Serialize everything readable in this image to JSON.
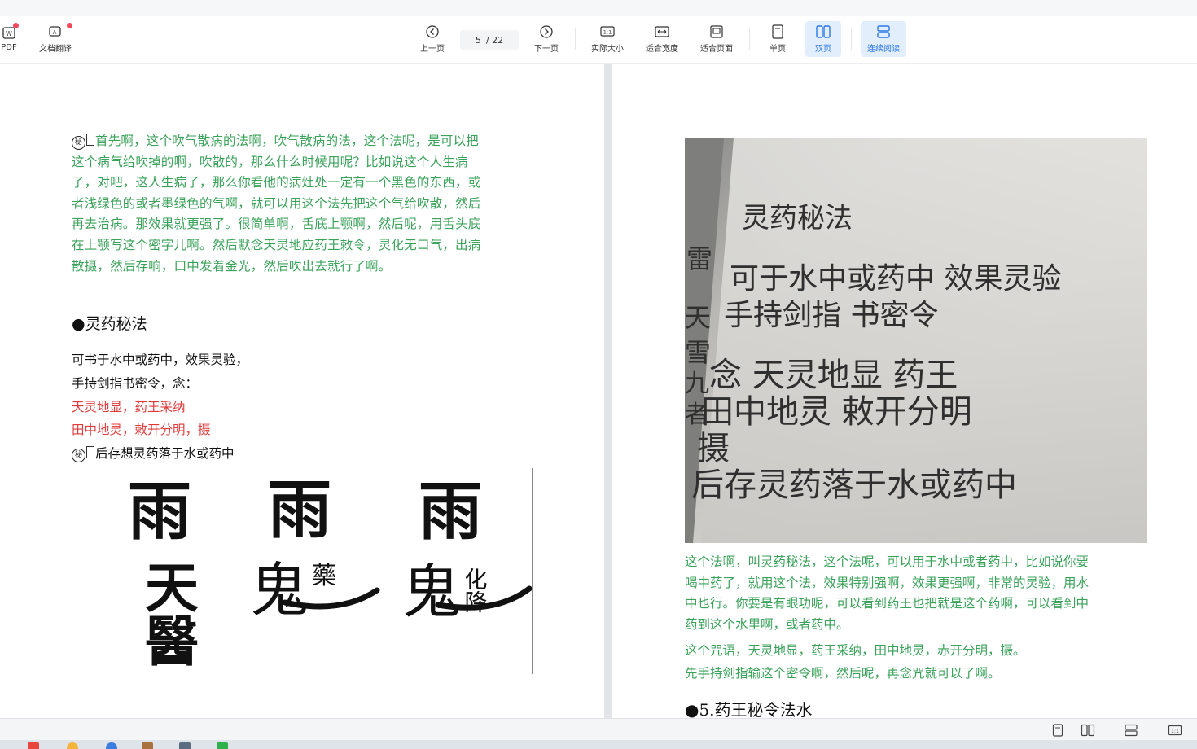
{
  "toolbar": {
    "left_items": [
      {
        "label": "PDF",
        "icon": "word-icon"
      },
      {
        "label": "文档翻译",
        "icon": "translate-icon"
      }
    ],
    "prev_label": "上一页",
    "current_page": "5",
    "total_pages": "/ 22",
    "next_label": "下一页",
    "actual_size_label": "实际大小",
    "fit_width_label": "适合宽度",
    "fit_page_label": "适合页面",
    "single_label": "单页",
    "double_label": "双页",
    "continuous_label": "连续阅读",
    "accent_color": "#2a78e8",
    "badge_color": "#f04a5e"
  },
  "left_page": {
    "intro_lines": [
      "首先啊，这个吹气散病的法啊，吹气散病的法，这个法呢，是可以把",
      "这个病气给吹掉的啊，吹散的，那么什么时候用呢？比如说这个人生病",
      "了，对吧，这人生病了，那么你看他的病灶处一定有一个黑色的东西，或",
      "者浅绿色的或者墨绿色的气啊，就可以用这个法先把这个气给吹散，然后",
      "再去治病。那效果就更强了。很简单啊，舌底上颚啊，然后呢，用舌头底",
      "在上颚写这个密字儿啊。然后默念天灵地应药王敕令，灵化无口气，出病",
      "散摄，然后存响，口中发着金光，然后吹出去就行了啊。"
    ],
    "seal_char": "秘",
    "heading": "●灵药秘法",
    "line1": "可书于水中或药中，效果灵验，",
    "line2": "手持剑指书密令，念：",
    "line3": "天灵地显，药王采纳",
    "line4": "田中地灵，敕开分明，摄",
    "line5": "后存想灵药落于水或药中",
    "glyph_top": "雨",
    "glyph1_bottom": "天醫",
    "glyph2_bottom": "鬼",
    "glyph2_inner": "藥",
    "glyph3_bottom": "鬼",
    "glyph3_inner": "化降"
  },
  "right_page": {
    "photo_lines": [
      "灵药秘法",
      "可于水中或药中 效果灵验",
      "手持剑指 书密令",
      "念 天灵地显 药王",
      "田中地灵 敕开分明",
      "摄",
      "后存灵药落于水或药中"
    ],
    "photo_edge_chars": [
      "雷",
      "天",
      "雪",
      "九",
      "者"
    ],
    "para_lines": [
      "这个法啊，叫灵药秘法，这个法呢，可以用于水中或者药中，比如说你要",
      "喝中药了，就用这个法，效果特别强啊，效果更强啊，非常的灵验，用水",
      "中也行。你要是有眼功呢，可以看到药王也把就是这个药啊，可以看到中",
      "药到这个水里啊，或者药中。"
    ],
    "line_a": "这个咒语，天灵地显，药王采纳，田中地灵，赤开分明，摄。",
    "line_b": "先手持剑指输这个密令啊，然后呢，再念咒就可以了啊。",
    "heading": "●5.药王秘令法水"
  },
  "statusbar": {
    "icons": [
      "single-page-icon",
      "double-page-icon",
      "continuous-icon",
      "actual-size-icon"
    ]
  }
}
